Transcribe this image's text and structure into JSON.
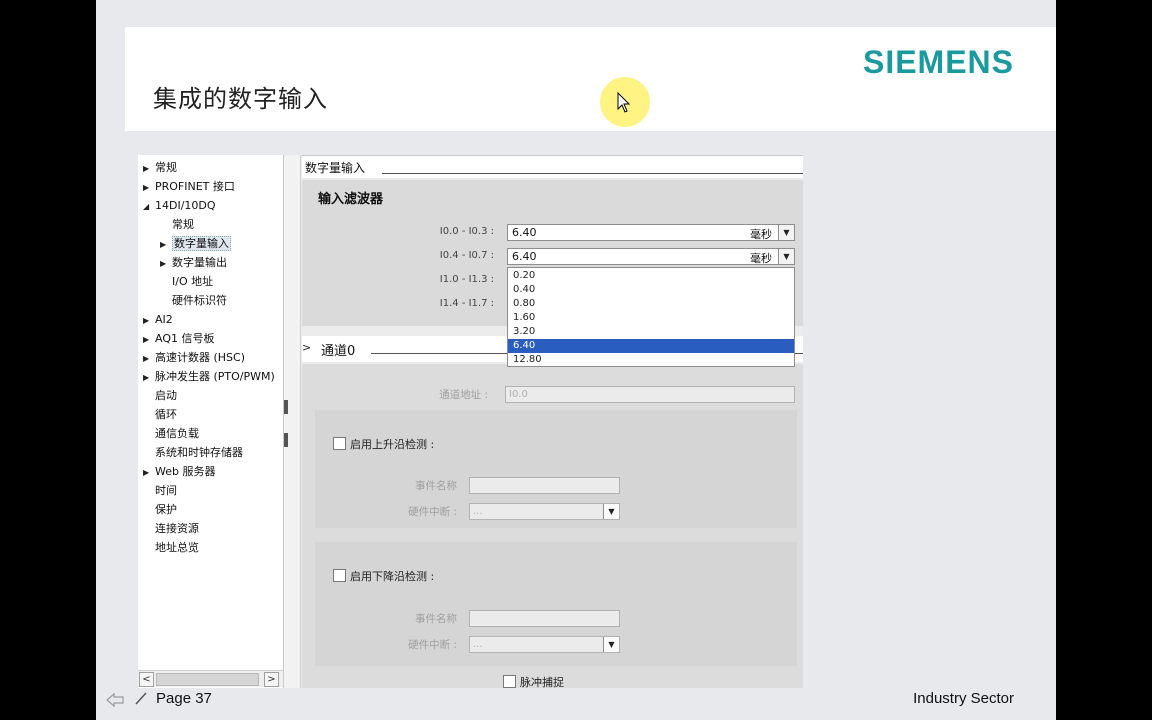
{
  "slide": {
    "title": "集成的数字输入",
    "brand": "SIEMENS",
    "page_label": "Page 37",
    "sector": "Industry Sector"
  },
  "tree": {
    "items": [
      {
        "label": "常规",
        "arrow": "▶"
      },
      {
        "label": "PROFINET 接口",
        "arrow": "▶"
      },
      {
        "label": "14DI/10DQ",
        "arrow": "◢"
      },
      {
        "label": "常规",
        "arrow": ""
      },
      {
        "label": "数字量输入",
        "arrow": "▶"
      },
      {
        "label": "数字量输出",
        "arrow": "▶"
      },
      {
        "label": "I/O 地址",
        "arrow": ""
      },
      {
        "label": "硬件标识符",
        "arrow": ""
      },
      {
        "label": "AI2",
        "arrow": "▶"
      },
      {
        "label": "AQ1 信号板",
        "arrow": "▶"
      },
      {
        "label": "高速计数器 (HSC)",
        "arrow": "▶"
      },
      {
        "label": "脉冲发生器 (PTO/PWM)",
        "arrow": "▶"
      },
      {
        "label": "启动",
        "arrow": ""
      },
      {
        "label": "循环",
        "arrow": ""
      },
      {
        "label": "通信负载",
        "arrow": ""
      },
      {
        "label": "系统和时钟存储器",
        "arrow": ""
      },
      {
        "label": "Web 服务器",
        "arrow": "▶"
      },
      {
        "label": "时间",
        "arrow": ""
      },
      {
        "label": "保护",
        "arrow": ""
      },
      {
        "label": "连接资源",
        "arrow": ""
      },
      {
        "label": "地址总览",
        "arrow": ""
      }
    ],
    "scroll_left": "<",
    "scroll_right": ">"
  },
  "panel": {
    "section_title": "数字量输入",
    "filter_title": "输入滤波器",
    "rows": [
      {
        "label": "I0.0 - I0.3 :",
        "value": "6.40",
        "unit": "毫秒"
      },
      {
        "label": "I0.4 - I0.7 :",
        "value": "6.40",
        "unit": "毫秒"
      },
      {
        "label": "I1.0 - I1.3 :"
      },
      {
        "label": "I1.4 - I1.7 :"
      }
    ],
    "dropdown_icon": "▼",
    "dropdown_options": [
      "0.20",
      "0.40",
      "0.80",
      "1.60",
      "3.20",
      "6.40",
      "12.80"
    ],
    "dropdown_selected": "6.40",
    "channel_title": "通道0",
    "channel_chevron": ">",
    "channel_address_label": "通道地址 :",
    "channel_address_value": "I0.0",
    "rising_edge_label": "启用上升沿检测 :",
    "falling_edge_label": "启用下降沿检测 :",
    "event_name_label": "事件名称",
    "hw_interrupt_label": "硬件中断 :",
    "hw_interrupt_value": "...",
    "pulse_catch_label": "脉冲捕捉"
  },
  "colors": {
    "brand": "#1a9a9f",
    "selection": "#2a5dc0",
    "cursor_highlight": "#fff05a"
  }
}
